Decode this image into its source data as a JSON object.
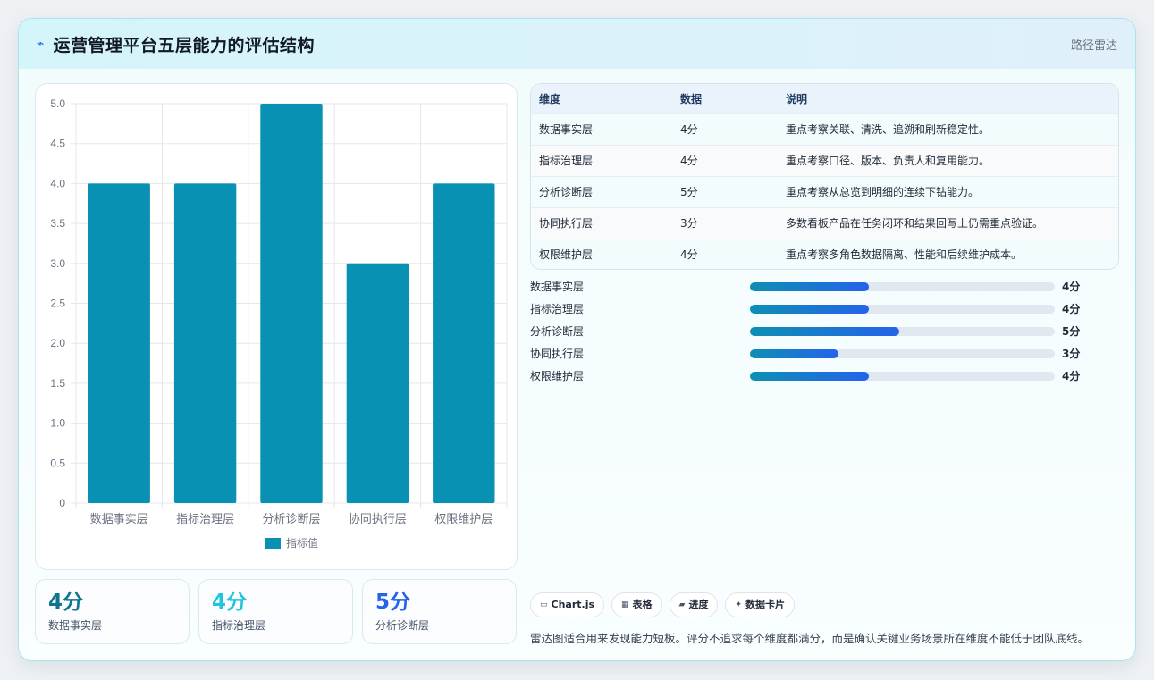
{
  "header": {
    "icon": "bolt-icon",
    "title": "运营管理平台五层能力的评估结构",
    "badge": "路径雷达"
  },
  "chart_data": {
    "type": "bar",
    "categories": [
      "数据事实层",
      "指标治理层",
      "分析诊断层",
      "协同执行层",
      "权限维护层"
    ],
    "series": [
      {
        "name": "指标值",
        "values": [
          4,
          4,
          5,
          3,
          4
        ],
        "color": "#0891b2"
      }
    ],
    "ylim": [
      0,
      5
    ],
    "yticks": [
      "0",
      "0.5",
      "1.0",
      "1.5",
      "2.0",
      "2.5",
      "3.0",
      "3.5",
      "4.0",
      "4.5",
      "5.0"
    ],
    "grid": true,
    "legend": "bottom"
  },
  "stats": [
    {
      "value": "4分",
      "label": "数据事实层",
      "color": "#0e7490"
    },
    {
      "value": "4分",
      "label": "指标治理层",
      "color": "#22c5dd"
    },
    {
      "value": "5分",
      "label": "分析诊断层",
      "color": "#2563eb"
    }
  ],
  "table": {
    "headers": [
      "维度",
      "数据",
      "说明"
    ],
    "rows": [
      [
        "数据事实层",
        "4分",
        "重点考察关联、清洗、追溯和刷新稳定性。"
      ],
      [
        "指标治理层",
        "4分",
        "重点考察口径、版本、负责人和复用能力。"
      ],
      [
        "分析诊断层",
        "5分",
        "重点考察从总览到明细的连续下钻能力。"
      ],
      [
        "协同执行层",
        "3分",
        "多数看板产品在任务闭环和结果回写上仍需重点验证。"
      ],
      [
        "权限维护层",
        "4分",
        "重点考察多角色数据隔离、性能和后续维护成本。"
      ]
    ]
  },
  "progress": [
    {
      "label": "数据事实层",
      "value": "4分",
      "fraction": 0.39
    },
    {
      "label": "指标治理层",
      "value": "4分",
      "fraction": 0.39
    },
    {
      "label": "分析诊断层",
      "value": "5分",
      "fraction": 0.49
    },
    {
      "label": "协同执行层",
      "value": "3分",
      "fraction": 0.29
    },
    {
      "label": "权限维护层",
      "value": "4分",
      "fraction": 0.39
    }
  ],
  "chips": [
    {
      "icon": "window-icon",
      "label": "Chart.js"
    },
    {
      "icon": "table-icon",
      "label": "表格"
    },
    {
      "icon": "progress-icon",
      "label": "进度"
    },
    {
      "icon": "sparkle-icon",
      "label": "数据卡片"
    }
  ],
  "note": "雷达图适合用来发现能力短板。评分不追求每个维度都满分，而是确认关键业务场景所在维度不能低于团队底线。"
}
